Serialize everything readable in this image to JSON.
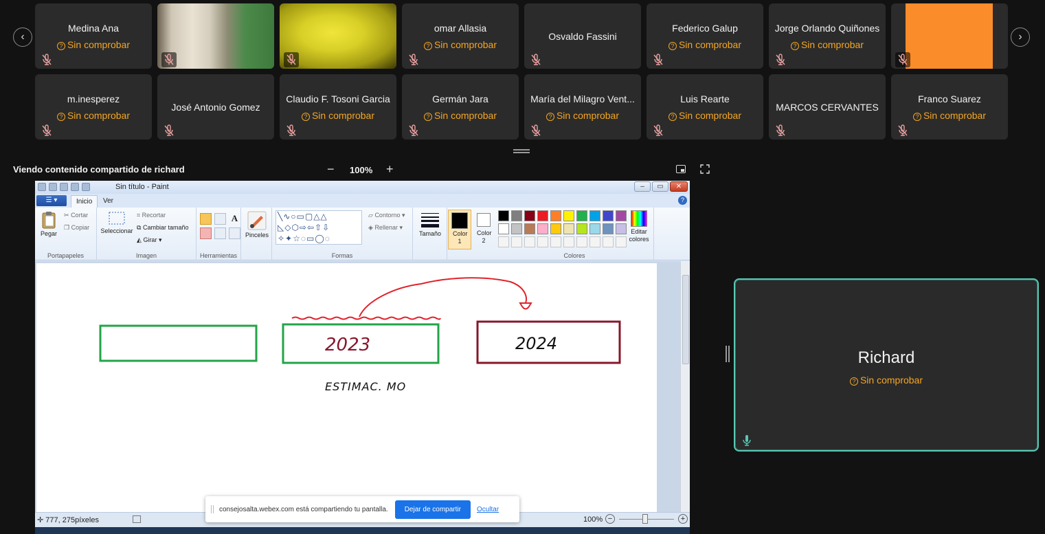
{
  "participants": [
    {
      "name": "Medina Ana",
      "status": "Sin comprobar"
    },
    {
      "name": "",
      "status": ""
    },
    {
      "name": "",
      "status": ""
    },
    {
      "name": "omar Allasia",
      "status": "Sin comprobar"
    },
    {
      "name": "Osvaldo Fassini",
      "status": ""
    },
    {
      "name": "Federico Galup",
      "status": "Sin comprobar"
    },
    {
      "name": "Jorge Orlando Quiñones",
      "status": "Sin comprobar"
    },
    {
      "name": "",
      "status": ""
    },
    {
      "name": "m.inesperez",
      "status": "Sin comprobar"
    },
    {
      "name": "José Antonio Gomez",
      "status": ""
    },
    {
      "name": "Claudio F. Tosoni Garcia",
      "status": "Sin comprobar"
    },
    {
      "name": "Germán Jara",
      "status": "Sin comprobar"
    },
    {
      "name": "María del Milagro Vent...",
      "status": "Sin comprobar"
    },
    {
      "name": "Luis Rearte",
      "status": "Sin comprobar"
    },
    {
      "name": "MARCOS CERVANTES",
      "status": ""
    },
    {
      "name": "Franco Suarez",
      "status": "Sin comprobar"
    }
  ],
  "share": {
    "title": "Viendo contenido compartido de richard",
    "zoom": "100%",
    "zoom_minus": "−",
    "zoom_plus": "+"
  },
  "paint": {
    "window_title": "Sin título - Paint",
    "tabs": [
      "Inicio",
      "Ver"
    ],
    "file_menu": "▾",
    "clipboard": {
      "paste": "Pegar",
      "cut": "Cortar",
      "copy": "Copiar",
      "label": "Portapapeles"
    },
    "image": {
      "select": "Seleccionar",
      "crop": "Recortar",
      "resize": "Cambiar tamaño",
      "rotate": "Girar",
      "label": "Imagen"
    },
    "tools": {
      "label": "Herramientas"
    },
    "brushes": "Pinceles",
    "shapes": {
      "outline": "Contorno",
      "fill": "Rellenar",
      "label": "Formas"
    },
    "size": "Tamaño",
    "color1": "Color 1",
    "color2": "Color 2",
    "colors_label": "Colores",
    "edit_colors": "Editar colores",
    "palette": [
      "#000000",
      "#7f7f7f",
      "#880015",
      "#ed1c24",
      "#ff7f27",
      "#fff200",
      "#22b14c",
      "#00a2e8",
      "#3f48cc",
      "#a349a4",
      "#ffffff",
      "#c3c3c3",
      "#b97a57",
      "#ffaec9",
      "#ffc90e",
      "#efe4b0",
      "#b5e61d",
      "#99d9ea",
      "#7092be",
      "#c8bfe7"
    ],
    "canvas_text": {
      "box2": "2023",
      "box3": "2024",
      "note": "ESTIMAC. MO"
    },
    "status": {
      "coords": "777, 275píxeles",
      "zoom": "100%",
      "minus": "−",
      "plus": "+"
    }
  },
  "share_bar": {
    "message": "consejosalta.webex.com está compartiendo tu pantalla.",
    "stop": "Dejar de compartir",
    "hide": "Ocultar"
  },
  "speaker": {
    "name": "Richard",
    "status": "Sin comprobar"
  },
  "colors": {
    "status": "#f5a623",
    "speaker_border": "#58c7b3",
    "tile_bg": "#2b2b2b"
  }
}
